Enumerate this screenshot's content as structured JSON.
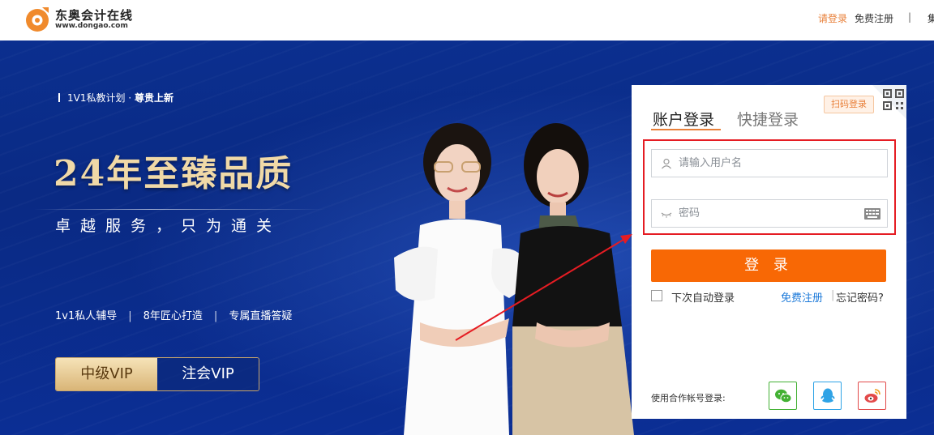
{
  "header": {
    "logo_name": "东奥会计在线",
    "logo_url": "www.dongao.com",
    "login_link": "请登录",
    "register_link": "免费注册",
    "separator": "|",
    "more_link": "集"
  },
  "banner": {
    "tagline_prefix": "1V1私教计划 · ",
    "tagline_strong": "尊贵上新",
    "headline": "24年至臻品质",
    "subline": "卓越服务，只为通关",
    "features": [
      "1v1私人辅导",
      "8年匠心打造",
      "专属直播答疑"
    ],
    "feature_separator": "|",
    "vip_buttons": [
      "中级VIP",
      "注会VIP"
    ]
  },
  "login": {
    "tabs": [
      "账户登录",
      "快捷登录"
    ],
    "qr_badge": "扫码登录",
    "username_placeholder": "请输入用户名",
    "password_placeholder": "密码",
    "login_button": "登 录",
    "remember_label": "下次自动登录",
    "register_link": "免费注册",
    "link_separator": "|",
    "forgot_link": "忘记密码?",
    "oauth_label": "使用合作帐号登录:"
  },
  "colors": {
    "accent_orange": "#f86805",
    "link_blue": "#1d7ad9",
    "annotation_red": "#e51c23",
    "banner_blue": "#0b2f8f",
    "gold": "#f0d9a7"
  }
}
